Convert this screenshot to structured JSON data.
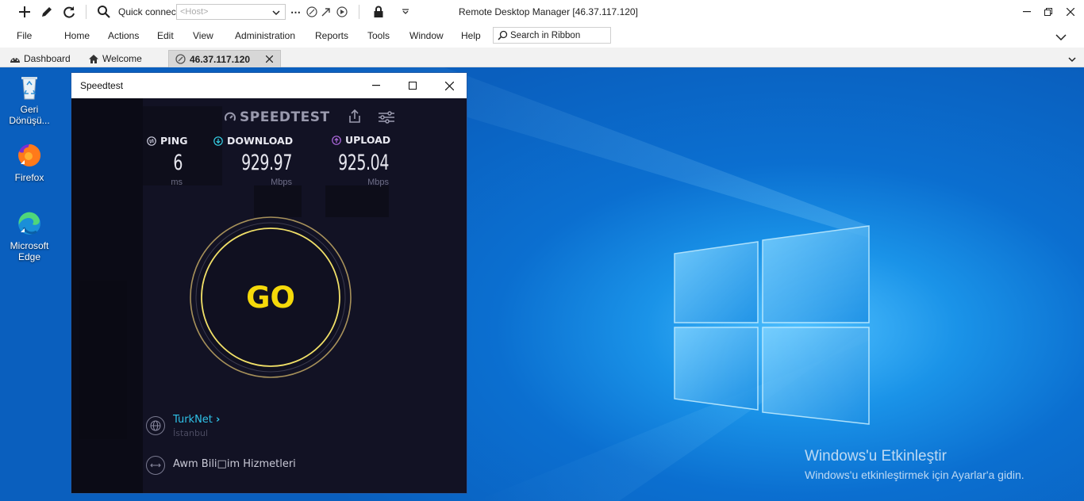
{
  "titlebar": {
    "quick_connect_label": "Quick connect",
    "host_placeholder": "<Host>",
    "window_title": "Remote Desktop Manager [46.37.117.120]"
  },
  "menu": {
    "items": [
      "File",
      "Home",
      "Actions",
      "Edit",
      "View",
      "Administration",
      "Reports",
      "Tools",
      "Window",
      "Help"
    ],
    "search_label": "Search in Ribbon"
  },
  "tabs": {
    "dashboard": "Dashboard",
    "welcome": "Welcome",
    "session": "46.37.117.120"
  },
  "desktop": {
    "icons": [
      "Geri Dönüşü...",
      "Firefox",
      "Microsoft Edge"
    ],
    "activate_title": "Windows'u Etkinleştir",
    "activate_sub": "Windows'u etkinleştirmek için Ayarlar'a gidin."
  },
  "speedtest": {
    "window_title": "Speedtest",
    "logo": "SPEEDTEST",
    "ping": {
      "label": "PING",
      "value": "6",
      "unit": "ms"
    },
    "download": {
      "label": "DOWNLOAD",
      "value": "929.97",
      "unit": "Mbps"
    },
    "upload": {
      "label": "UPLOAD",
      "value": "925.04",
      "unit": "Mbps"
    },
    "go": "GO",
    "isp": {
      "name": "TurkNet",
      "location": "İstanbul"
    },
    "host": "Awm Bili□im Hizmetleri"
  },
  "colors": {
    "go_yellow": "#f5d90a",
    "isp_cyan": "#2fc2e8",
    "desktop_blue": "#0b6fd0",
    "speedtest_bg": "#121224"
  }
}
